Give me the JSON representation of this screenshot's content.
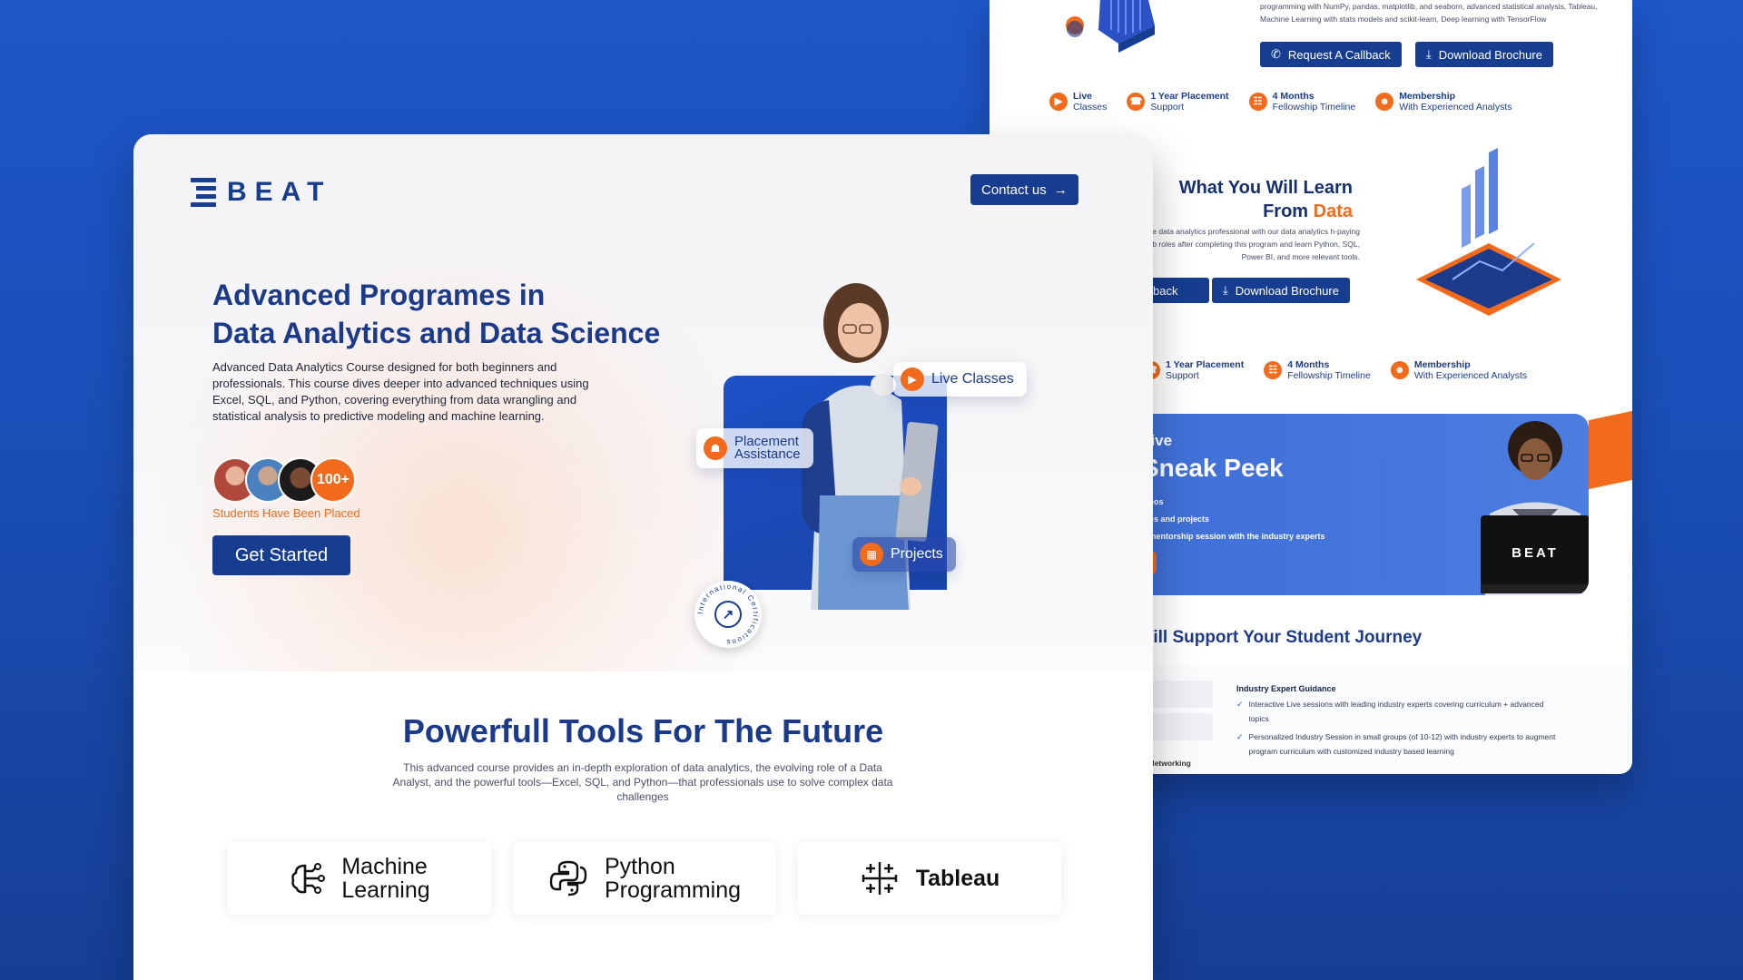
{
  "back_page": {
    "top_text": "programming with NumPy, pandas, matplotlib, and seaborn, advanced statistical analysis, Tableau, Machine Learning with stats models and scikit-learn, Deep learning with TensorFlow",
    "buttons": {
      "callback": "Request A Callback",
      "brochure": "Download Brochure"
    },
    "features_top": [
      {
        "title": "Live",
        "sub": "Classes"
      },
      {
        "title": "1 Year Placement",
        "sub": "Support"
      },
      {
        "title": "4 Months",
        "sub": "Fellowship Timeline"
      },
      {
        "title": "Membership",
        "sub": "With Experienced Analysts"
      }
    ],
    "learn_section": {
      "title_line1": "What You Will Learn",
      "title_line2_prefix": "From ",
      "title_line2_accent": "Data",
      "text": "ne data analytics professional with our data analytics h-paying job roles after completing this program and learn Python, SQL, Power BI, and more relevant tools.",
      "btn_partial": "back",
      "btn_brochure": "Download Brochure"
    },
    "features_mid": [
      {
        "title": "1 Year Placement",
        "sub": "Support"
      },
      {
        "title": "4 Months",
        "sub": "Fellowship Timeline"
      },
      {
        "title": "Membership",
        "sub": "With Experienced Analysts"
      }
    ],
    "sneak": {
      "line1": "sive",
      "line2": "Sneak Peek",
      "items": [
        "ideos",
        "dies and projects",
        "e mentorship session with the industry experts"
      ],
      "laptop_brand": "BEAT"
    },
    "journey": {
      "title": "Vill Support Your Student Journey",
      "left_label": "d Networking",
      "heading": "Industry Expert Guidance",
      "items": [
        "Interactive Live sessions with leading industry  experts covering curriculum + advanced topics",
        "Personalized Industry Session in small groups (of 10-12) with industry experts to augment program curriculum with customized industry based learning"
      ]
    }
  },
  "front_page": {
    "brand": "BEAT",
    "contact_label": "Contact us",
    "hero": {
      "title_line1": "Advanced Programes in",
      "title_line2": "Data Analytics and Data Science",
      "description": "Advanced Data Analytics Course designed for both beginners and professionals. This course dives deeper into advanced techniques using Excel, SQL, and Python, covering everything from data wrangling and statistical analysis to predictive modeling and machine learning.",
      "placed_count": "100+",
      "placed_label": "Students Have Been Placed",
      "cta_label": "Get Started"
    },
    "chips": {
      "live": "Live Classes",
      "placement_line1": "Placement",
      "placement_line2": "Assistance",
      "projects": "Projects"
    },
    "certification_badge": "International Certifications",
    "tools": {
      "title": "Powerfull Tools For The Future",
      "description": "This advanced course provides an in-depth exploration of data analytics, the evolving role of a Data Analyst, and the powerful tools—Excel, SQL, and Python—that professionals use to solve complex data challenges",
      "cards": [
        {
          "name": "Machine",
          "sub": "Learning",
          "icon": "brain-circuit-icon"
        },
        {
          "name": "Python",
          "sub": "Programming",
          "icon": "python-icon"
        },
        {
          "name": "Tableau",
          "sub": "",
          "icon": "tableau-icon"
        }
      ]
    }
  },
  "colors": {
    "background": "#1e56c8",
    "brand_blue": "#163d8f",
    "accent_orange": "#f26a1b"
  }
}
